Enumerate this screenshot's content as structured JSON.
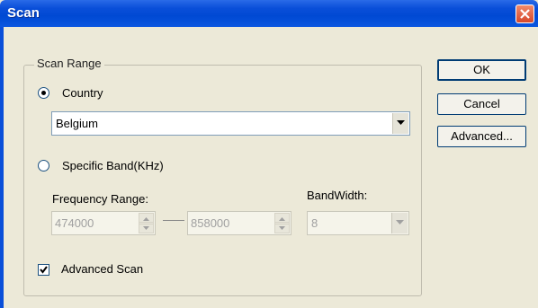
{
  "window": {
    "title": "Scan"
  },
  "group": {
    "legend": "Scan Range"
  },
  "country_option": {
    "label": "Country",
    "selected": true
  },
  "country_select": {
    "value": "Belgium"
  },
  "band_option": {
    "label": "Specific Band(KHz)",
    "selected": false
  },
  "frequency": {
    "label": "Frequency Range:",
    "from": "474000",
    "to": "858000"
  },
  "bandwidth": {
    "label": "BandWidth:",
    "value": "8"
  },
  "advanced_scan": {
    "label": "Advanced Scan",
    "checked": true
  },
  "buttons": {
    "ok": "OK",
    "cancel": "Cancel",
    "advanced": "Advanced..."
  }
}
